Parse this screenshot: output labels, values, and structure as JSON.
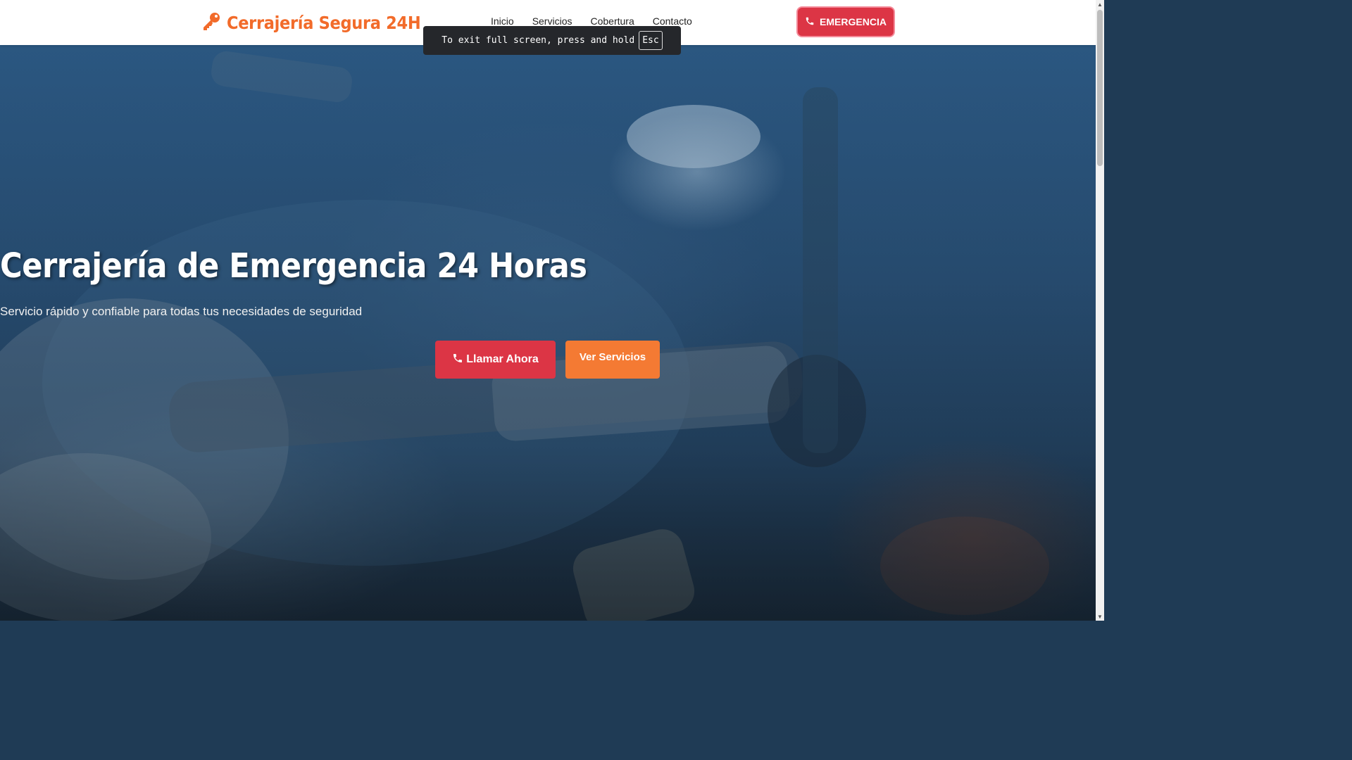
{
  "header": {
    "logo_text": "Cerrajería Segura 24H",
    "nav": [
      {
        "label": "Inicio"
      },
      {
        "label": "Servicios"
      },
      {
        "label": "Cobertura"
      },
      {
        "label": "Contacto"
      }
    ],
    "emergency_label": "EMERGENCIA"
  },
  "fullscreen_notice": {
    "message": "To exit full screen, press and hold",
    "key": "Esc"
  },
  "hero": {
    "title": "Cerrajería de Emergencia 24 Horas",
    "subtitle": "Servicio rápido y confiable para todas tus necesidades de seguridad",
    "primary_button": "Llamar Ahora",
    "secondary_button": "Ver Servicios"
  },
  "colors": {
    "brand_orange": "#f26b2a",
    "emergency_red": "#dc3545",
    "secondary_orange": "#f47a33"
  },
  "icons": {
    "logo": "key-icon",
    "phone": "phone-icon"
  }
}
